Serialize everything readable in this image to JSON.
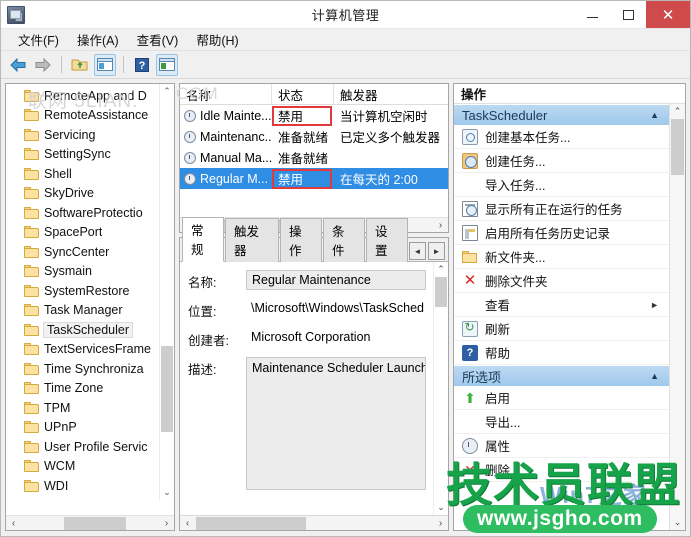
{
  "window": {
    "title": "计算机管理",
    "app_icon": "computer-management-icon",
    "controls": {
      "minimize": "–",
      "maximize": "□",
      "close": "✕"
    }
  },
  "menubar": {
    "items": [
      {
        "label": "文件(F)"
      },
      {
        "label": "操作(A)"
      },
      {
        "label": "查看(V)"
      },
      {
        "label": "帮助(H)"
      }
    ]
  },
  "toolbar": {
    "buttons": [
      {
        "name": "back-icon",
        "glyph": "⬅"
      },
      {
        "name": "forward-icon",
        "glyph": "➡"
      },
      {
        "name": "up-folder-icon",
        "glyph": "📂"
      },
      {
        "name": "show-hide-console-tree-icon",
        "glyph": "▤"
      },
      {
        "name": "help-icon",
        "glyph": "?"
      },
      {
        "name": "show-hide-action-pane-icon",
        "glyph": "▥"
      }
    ]
  },
  "tree": {
    "items": [
      {
        "label": "RemoteApp and D",
        "selected": false
      },
      {
        "label": "RemoteAssistance",
        "selected": false
      },
      {
        "label": "Servicing",
        "selected": false
      },
      {
        "label": "SettingSync",
        "selected": false
      },
      {
        "label": "Shell",
        "selected": false
      },
      {
        "label": "SkyDrive",
        "selected": false
      },
      {
        "label": "SoftwareProtectio",
        "selected": false
      },
      {
        "label": "SpacePort",
        "selected": false
      },
      {
        "label": "SyncCenter",
        "selected": false
      },
      {
        "label": "Sysmain",
        "selected": false
      },
      {
        "label": "SystemRestore",
        "selected": false
      },
      {
        "label": "Task Manager",
        "selected": false
      },
      {
        "label": "TaskScheduler",
        "selected": true
      },
      {
        "label": "TextServicesFrame",
        "selected": false
      },
      {
        "label": "Time Synchroniza",
        "selected": false
      },
      {
        "label": "Time Zone",
        "selected": false
      },
      {
        "label": "TPM",
        "selected": false
      },
      {
        "label": "UPnP",
        "selected": false
      },
      {
        "label": "User Profile Servic",
        "selected": false
      },
      {
        "label": "WCM",
        "selected": false
      },
      {
        "label": "WDI",
        "selected": false
      }
    ],
    "scroll_up": "⌃",
    "scroll_down": "⌄",
    "scroll_left": "‹",
    "scroll_right": "›"
  },
  "tasklist": {
    "columns": [
      "名称",
      "状态",
      "触发器"
    ],
    "rows": [
      {
        "name": "Idle Mainte...",
        "status": "禁用",
        "trigger": "当计算机空闲时",
        "selected": false,
        "status_highlight": true
      },
      {
        "name": "Maintenanc...",
        "status": "准备就绪",
        "trigger": "已定义多个触发器",
        "selected": false,
        "status_highlight": false
      },
      {
        "name": "Manual Ma...",
        "status": "准备就绪",
        "trigger": "",
        "selected": false,
        "status_highlight": false
      },
      {
        "name": "Regular M...",
        "status": "禁用",
        "trigger": "在每天的 2:00",
        "selected": true,
        "status_highlight": true
      }
    ],
    "scroll_left": "‹",
    "scroll_right": "›"
  },
  "detail": {
    "tabs": [
      {
        "label": "常规",
        "active": true
      },
      {
        "label": "触发器",
        "active": false
      },
      {
        "label": "操作",
        "active": false
      },
      {
        "label": "条件",
        "active": false
      },
      {
        "label": "设置",
        "active": false
      }
    ],
    "tab_prev": "◄",
    "tab_next": "►",
    "fields": [
      {
        "label": "名称:",
        "value": "Regular Maintenance"
      },
      {
        "label": "位置:",
        "value": "\\Microsoft\\Windows\\TaskSched"
      },
      {
        "label": "创建者:",
        "value": "Microsoft Corporation"
      },
      {
        "label": "描述:",
        "value": "Maintenance Scheduler Launch"
      }
    ],
    "scroll_up": "⌃",
    "scroll_down": "⌄",
    "scroll_left": "‹",
    "scroll_right": "›"
  },
  "actions": {
    "title": "操作",
    "groups": [
      {
        "header": "TaskScheduler",
        "caret": "▲",
        "items": [
          {
            "label": "创建基本任务...",
            "icon": "create-basic-task-icon"
          },
          {
            "label": "创建任务...",
            "icon": "create-task-icon"
          },
          {
            "label": "导入任务...",
            "icon": ""
          },
          {
            "label": "显示所有正在运行的任务",
            "icon": "show-running-tasks-icon"
          },
          {
            "label": "启用所有任务历史记录",
            "icon": "enable-task-history-icon"
          },
          {
            "label": "新文件夹...",
            "icon": "new-folder-icon"
          },
          {
            "label": "删除文件夹",
            "icon": "delete-folder-icon"
          },
          {
            "label": "查看",
            "icon": "",
            "submenu_arrow": "►"
          },
          {
            "label": "刷新",
            "icon": "refresh-icon"
          },
          {
            "label": "帮助",
            "icon": "help-icon"
          }
        ]
      },
      {
        "header": "所选项",
        "caret": "▲",
        "items": [
          {
            "label": "启用",
            "icon": "enable-icon"
          },
          {
            "label": "导出...",
            "icon": ""
          },
          {
            "label": "属性",
            "icon": "properties-icon"
          },
          {
            "label": "删除",
            "icon": "delete-icon"
          }
        ]
      }
    ],
    "scroll_up": "⌃",
    "scroll_down": "⌄"
  },
  "watermarks": {
    "tree_overlay": "联网 5LIAN.",
    "list_overlay": "COM",
    "brand": "技术员联盟",
    "url": "www.jsgho.com",
    "site": "Win7之家"
  },
  "colors": {
    "accent_selection": "#2f8de4",
    "group_header": "#9fc9ec",
    "highlight_box": "#e03a3a",
    "close_button": "#cf4b4b",
    "watermark_green": "#2ebd60"
  }
}
